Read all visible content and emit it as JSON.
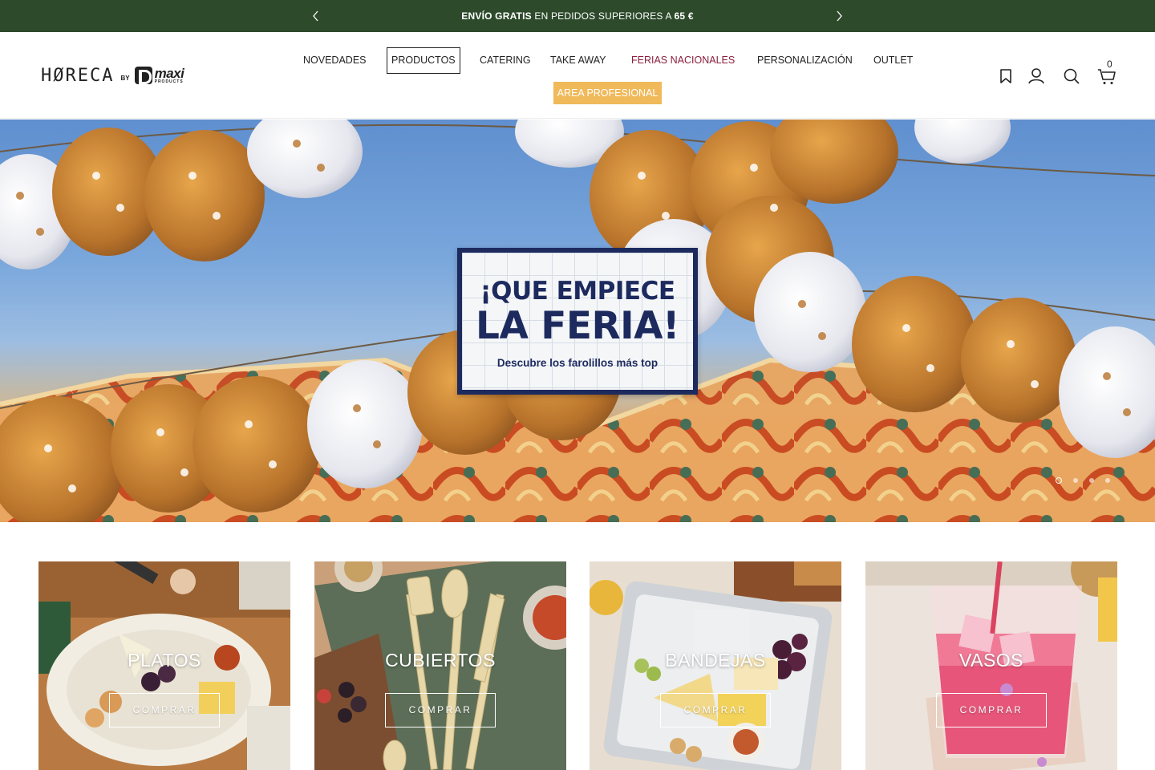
{
  "announcement": {
    "bold_lead": "ENVÍO GRATIS",
    "middle": " EN PEDIDOS SUPERIORES A ",
    "bold_amount": "65 €",
    "prev_icon": "chevron-left-icon",
    "next_icon": "chevron-right-icon"
  },
  "header": {
    "logo": {
      "word": "HØRECA",
      "by": "BY",
      "brand": "maxi",
      "brand_sub": "PRODUCTS"
    },
    "nav": {
      "novedades": "NOVEDADES",
      "productos": "PRODUCTOS",
      "catering": "CATERING",
      "take_away": "TAKE AWAY",
      "ferias": "FERIAS NACIONALES",
      "personalizacion": "PERSONALIZACIÓN",
      "outlet": "OUTLET",
      "area_profesional": "AREA PROFESIONAL"
    },
    "icons": [
      "bookmark-icon",
      "account-icon",
      "search-icon",
      "cart-icon"
    ],
    "cart_count": "0"
  },
  "hero": {
    "line1": "¡QUE EMPIECE",
    "line2": "LA FERIA!",
    "line3": "Descubre los farolillos más top",
    "slides": 4,
    "active_slide": 1
  },
  "categories": [
    {
      "label": "PLATOS",
      "button": "COMPRAR"
    },
    {
      "label": "CUBIERTOS",
      "button": "COMPRAR"
    },
    {
      "label": "BANDEJAS",
      "button": "COMPRAR"
    },
    {
      "label": "VASOS",
      "button": "COMPRAR"
    }
  ],
  "colors": {
    "announcement_bg": "#2d4a2b",
    "ferias_link": "#8b1e3f",
    "area_profesional_bg": "#f0b95a",
    "hero_card_border": "#1d2a5e"
  }
}
